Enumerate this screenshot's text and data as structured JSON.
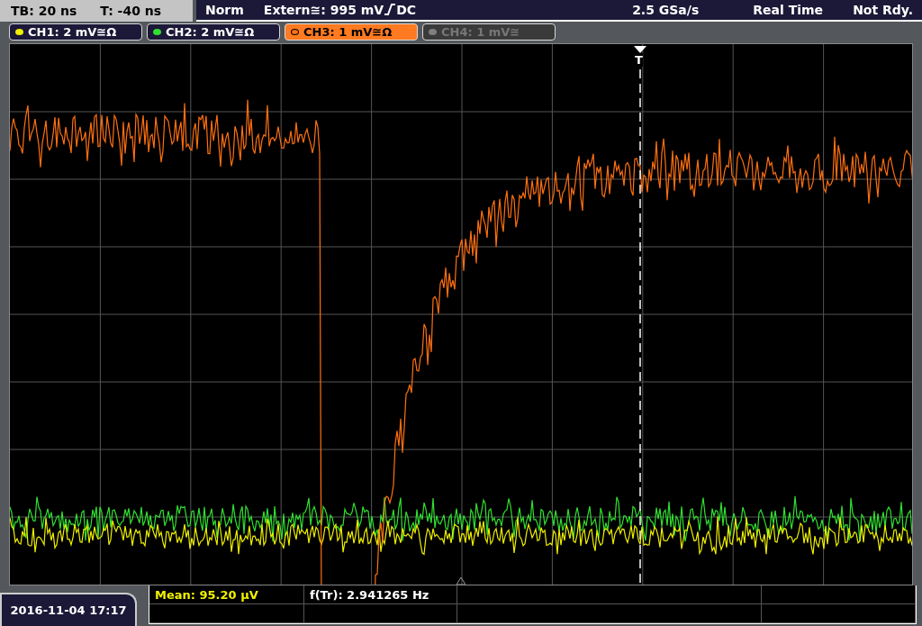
{
  "timebase": {
    "tb": "TB: 20 ns",
    "t": "T: -40 ns"
  },
  "trigger": {
    "mode": "Norm",
    "source": "Extern≅: 995 mV",
    "coupling": "DC"
  },
  "status": {
    "sample_rate": "2.5 GSa/s",
    "acquisition": "Real Time",
    "state": "Not Rdy."
  },
  "channels": [
    {
      "label": "CH1: 2 mV≅Ω",
      "color": "#f0f000",
      "selected": false,
      "enabled": true
    },
    {
      "label": "CH2: 2 mV≅Ω",
      "color": "#30e030",
      "selected": false,
      "enabled": true
    },
    {
      "label": "CH3: 1 mV≅Ω",
      "color": "#ff7010",
      "selected": true,
      "enabled": true
    },
    {
      "label": "CH4: 1 mV≅",
      "color": "#808080",
      "selected": false,
      "enabled": false
    }
  ],
  "trigger_marker": {
    "label": "T"
  },
  "date": "2016-11-04 17:17",
  "measurements": [
    {
      "text": "Mean: 95.20 µV",
      "color": "#f0f000"
    },
    {
      "text": "f(Tr): 2.941265 Hz",
      "color": "#ffffff"
    }
  ]
}
